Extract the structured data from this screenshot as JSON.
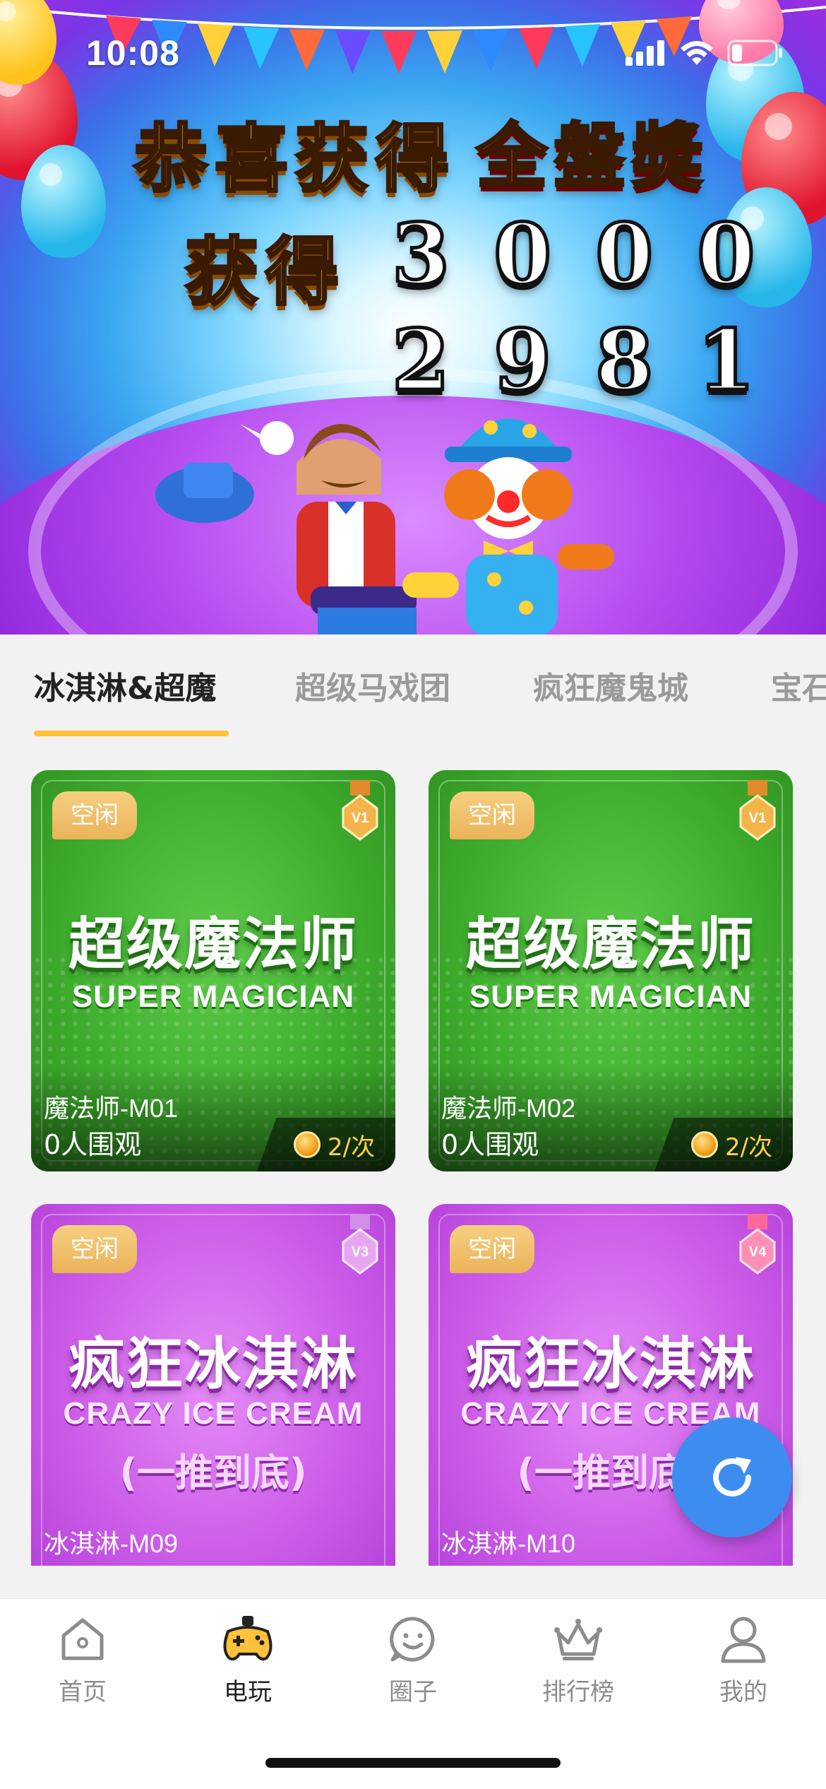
{
  "status_bar": {
    "time": "10:08"
  },
  "banner": {
    "line1_left": "恭喜获得",
    "line1_right": "全盤奬",
    "line2_label": "获得",
    "line2_number": "3000",
    "line3_number": "2981"
  },
  "tabs": [
    {
      "label": "冰淇淋&超魔",
      "active": true
    },
    {
      "label": "超级马戏团",
      "active": false
    },
    {
      "label": "疯狂魔鬼城",
      "active": false
    },
    {
      "label": "宝石",
      "active": false
    }
  ],
  "cards": [
    {
      "status": "空闲",
      "vip": "V1",
      "title_cn": "超级魔法师",
      "title_en": "SUPER MAGICIAN",
      "machine": "魔法师-M01",
      "watchers": "0人围观",
      "price": "2/次"
    },
    {
      "status": "空闲",
      "vip": "V1",
      "title_cn": "超级魔法师",
      "title_en": "SUPER MAGICIAN",
      "machine": "魔法师-M02",
      "watchers": "0人围观",
      "price": "2/次"
    },
    {
      "status": "空闲",
      "vip": "V3",
      "title_cn": "疯狂冰淇淋",
      "title_en": "CRAZY ICE CREAM",
      "subtitle": "(一推到底)",
      "machine": "冰淇淋-M09"
    },
    {
      "status": "空闲",
      "vip": "V4",
      "title_cn": "疯狂冰淇淋",
      "title_en": "CRAZY ICE CREAM",
      "subtitle": "(一推到底)",
      "machine": "冰淇淋-M10"
    }
  ],
  "bottom_nav": [
    {
      "label": "首页",
      "icon": "home-icon",
      "active": false
    },
    {
      "label": "电玩",
      "icon": "gamepad-icon",
      "active": true
    },
    {
      "label": "圈子",
      "icon": "smiley-chat-icon",
      "active": false
    },
    {
      "label": "排行榜",
      "icon": "crown-icon",
      "active": false
    },
    {
      "label": "我的",
      "icon": "user-icon",
      "active": false
    }
  ],
  "colors": {
    "accent_yellow": "#ffc23a",
    "fab_blue": "#3d8df0",
    "card_green": "#3fae2e",
    "card_purple": "#cc5de8"
  }
}
